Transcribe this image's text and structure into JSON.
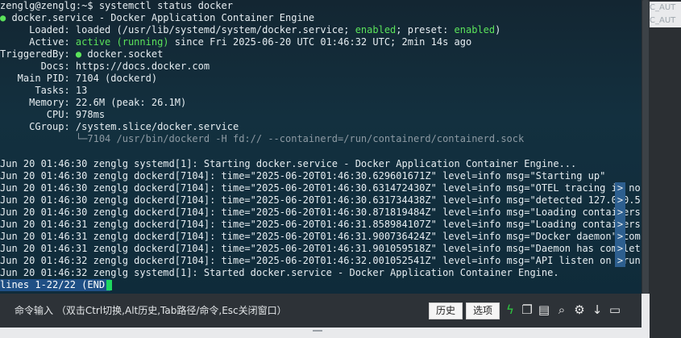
{
  "terminal": {
    "prompt": "zenglg@zenglg:~$ systemctl status docker",
    "unit_line": "docker.service - Docker Application Container Engine",
    "loaded_label": "     Loaded: ",
    "loaded_pre": "loaded (/usr/lib/systemd/system/docker.service; ",
    "loaded_enabled": "enabled",
    "loaded_mid": "; preset: ",
    "loaded_preset": "enabled",
    "loaded_post": ")",
    "active_label": "     Active: ",
    "active_status": "active (running)",
    "active_post": " since Fri 2025-06-20 UTC 01:46:32 UTC; 2min 14s ago",
    "triggered_label": "TriggeredBy: ",
    "triggered_value": "docker.socket",
    "docs": "       Docs: https://docs.docker.com",
    "mainpid": "   Main PID: 7104 (dockerd)",
    "tasks": "      Tasks: 13",
    "memory": "     Memory: 22.6M (peak: 26.1M)",
    "cpu": "        CPU: 978ms",
    "cgroup": "     CGroup: /system.slice/docker.service",
    "cgroup_child": "             └─7104 /usr/bin/dockerd -H fd:// --containerd=/run/containerd/containerd.sock",
    "logs": [
      "Jun 20 01:46:30 zenglg systemd[1]: Starting docker.service - Docker Application Container Engine...",
      "Jun 20 01:46:30 zenglg dockerd[7104]: time=\"2025-06-20T01:46:30.629601671Z\" level=info msg=\"Starting up\"",
      "Jun 20 01:46:30 zenglg dockerd[7104]: time=\"2025-06-20T01:46:30.631472430Z\" level=info msg=\"OTEL tracing is no",
      "Jun 20 01:46:30 zenglg dockerd[7104]: time=\"2025-06-20T01:46:30.631734438Z\" level=info msg=\"detected 127.0.0.5",
      "Jun 20 01:46:30 zenglg dockerd[7104]: time=\"2025-06-20T01:46:30.871819484Z\" level=info msg=\"Loading containers",
      "Jun 20 01:46:31 zenglg dockerd[7104]: time=\"2025-06-20T01:46:31.858984107Z\" level=info msg=\"Loading containers",
      "Jun 20 01:46:31 zenglg dockerd[7104]: time=\"2025-06-20T01:46:31.900736424Z\" level=info msg=\"Docker daemon\" com",
      "Jun 20 01:46:31 zenglg dockerd[7104]: time=\"2025-06-20T01:46:31.901059518Z\" level=info msg=\"Daemon has complet",
      "Jun 20 01:46:32 zenglg dockerd[7104]: time=\"2025-06-20T01:46:32.001052541Z\" level=info msg=\"API listen on /run",
      "Jun 20 01:46:32 zenglg systemd[1]: Started docker.service - Docker Application Container Engine."
    ],
    "truncation_marker": ">",
    "pager_status": "lines 1-22/22 (END)"
  },
  "right_panel": {
    "item1": "C_AUT",
    "item2": "C_AUT"
  },
  "cmdbar": {
    "label": "命令输入 （双击Ctrl切换,Alt历史,Tab路径/命令,Esc关闭窗口）",
    "history_button": "历史",
    "options_button": "选项",
    "icons": [
      "lightning-icon",
      "copy-icon",
      "paste-icon",
      "search-icon",
      "gear-icon",
      "download-icon",
      "window-icon"
    ]
  },
  "colors": {
    "terminal_bg": "#132632",
    "green": "#5be35b",
    "status_bar": "#1f4f85",
    "cursor": "#1ed760"
  }
}
